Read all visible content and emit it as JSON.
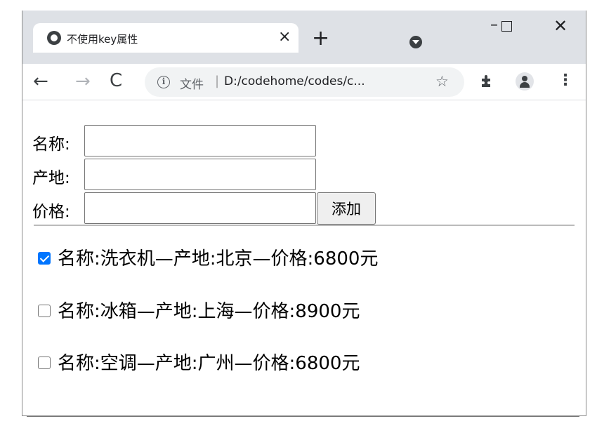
{
  "tab": {
    "title": "不使用key属性",
    "close": "×",
    "new_tab": "+"
  },
  "window": {
    "minimize": "–",
    "close": "✕"
  },
  "nav": {
    "back": "←",
    "forward": "→",
    "reload": "C"
  },
  "address": {
    "info": "i",
    "label": "文件",
    "sep": "|",
    "url": "D:/codehome/codes/c...",
    "star": "☆"
  },
  "menu": "⋮",
  "form": {
    "name_label": "名称:",
    "origin_label": "产地:",
    "price_label": "价格:",
    "name_value": "",
    "origin_value": "",
    "price_value": "",
    "add_label": "添加"
  },
  "items": [
    {
      "text": "名称:洗衣机—产地:北京—价格:6800元",
      "checked": true
    },
    {
      "text": "名称:冰箱—产地:上海—价格:8900元",
      "checked": false
    },
    {
      "text": "名称:空调—产地:广州—价格:6800元",
      "checked": false
    }
  ],
  "colors": {
    "checkbox_checked": "#0075ff",
    "tabstrip": "#dee1e6",
    "omnibox": "#f1f3f4"
  }
}
